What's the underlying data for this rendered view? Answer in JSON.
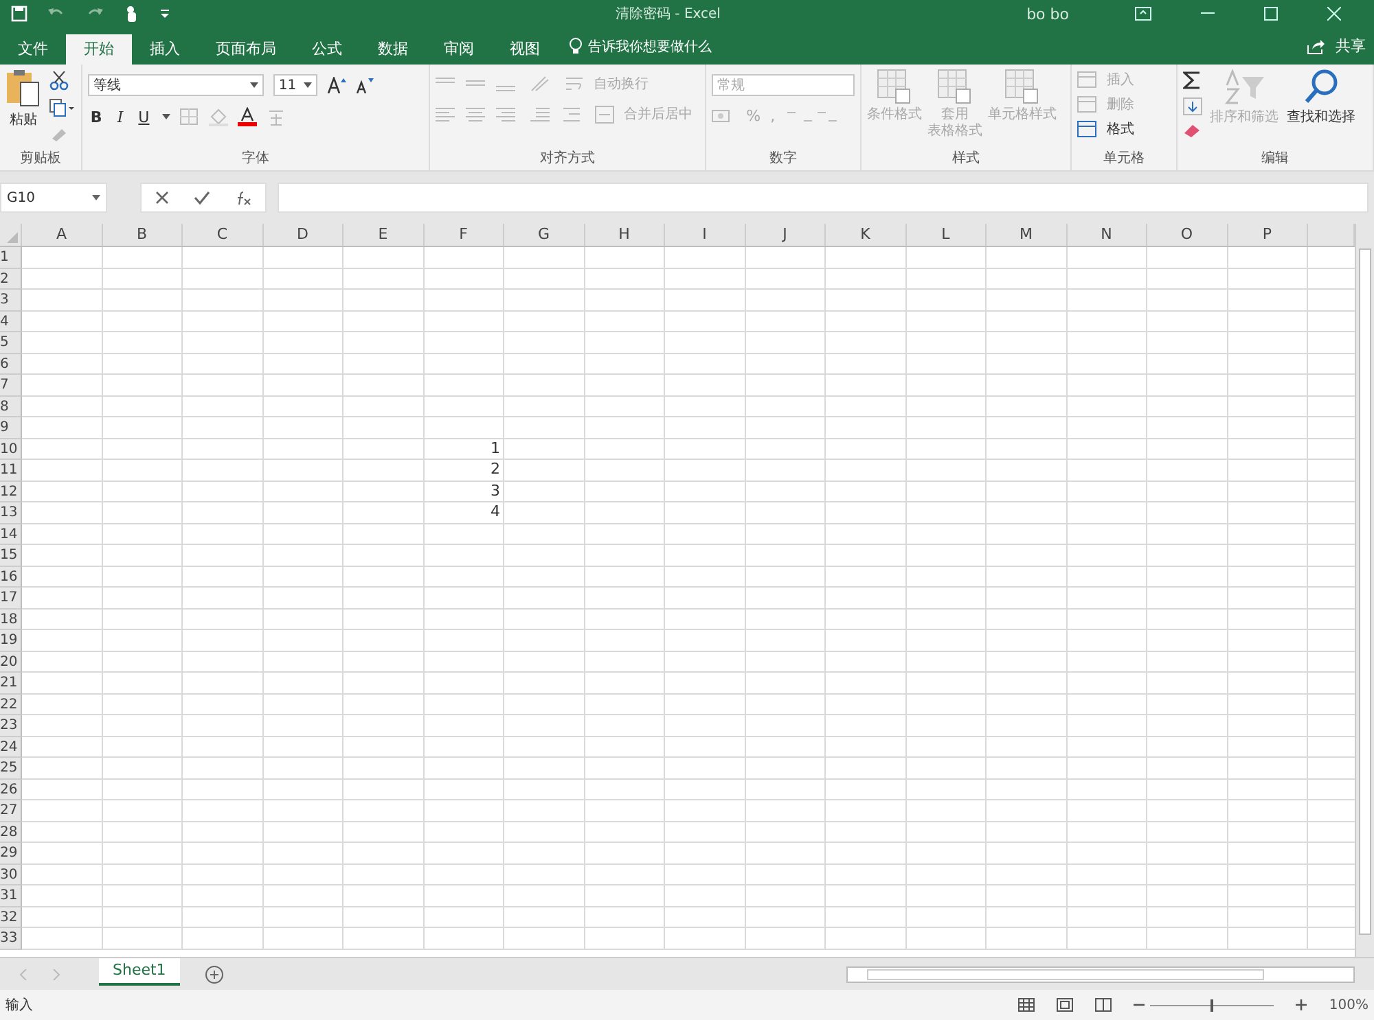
{
  "window": {
    "title": "清除密码 - Excel",
    "user": "bo bo"
  },
  "tabs": [
    {
      "label": "文件",
      "selected": false
    },
    {
      "label": "开始",
      "selected": true
    },
    {
      "label": "插入",
      "selected": false
    },
    {
      "label": "页面布局",
      "selected": false
    },
    {
      "label": "公式",
      "selected": false
    },
    {
      "label": "数据",
      "selected": false
    },
    {
      "label": "审阅",
      "selected": false
    },
    {
      "label": "视图",
      "selected": false
    }
  ],
  "tell_me": "告诉我你想要做什么",
  "share": "共享",
  "ribbon": {
    "clipboard": {
      "paste": "粘贴",
      "group": "剪贴板"
    },
    "font": {
      "name": "等线",
      "size": "11",
      "bold": "B",
      "italic": "I",
      "underline": "U",
      "group": "字体"
    },
    "alignment": {
      "wrap": "自动换行",
      "merge": "合并后居中",
      "group": "对齐方式"
    },
    "number": {
      "format": "常规",
      "percent": "%",
      "comma": ",",
      "group": "数字"
    },
    "styles": {
      "items": [
        {
          "label": "条件格式",
          "disabled": true
        },
        {
          "label": "套用",
          "label_2": "表格格式",
          "disabled": true
        },
        {
          "label": "单元格样式",
          "disabled": true
        }
      ],
      "group": "样式"
    },
    "cells": {
      "items": [
        {
          "label": "插入",
          "disabled": true
        },
        {
          "label": "删除",
          "disabled": true
        },
        {
          "label": "格式",
          "disabled": false
        }
      ],
      "group": "单元格"
    },
    "editing": {
      "sort": {
        "label": "排序和筛选",
        "disabled": true
      },
      "find": {
        "label": "查找和选择",
        "disabled": false
      },
      "group": "编辑"
    }
  },
  "formula_bar": {
    "name_box": "G10"
  },
  "sheet": {
    "columns": [
      "A",
      "B",
      "C",
      "D",
      "E",
      "F",
      "G",
      "H",
      "I",
      "J",
      "K",
      "L",
      "M",
      "N",
      "O",
      "P"
    ],
    "rows": [
      {
        "label": "1"
      },
      {
        "label": "2"
      },
      {
        "label": "3"
      },
      {
        "label": "4"
      },
      {
        "label": "5"
      },
      {
        "label": "6"
      },
      {
        "label": "7"
      },
      {
        "label": "8"
      },
      {
        "label": "9"
      },
      {
        "label": "10",
        "cells": [
          null,
          null,
          null,
          null,
          null,
          "1"
        ]
      },
      {
        "label": "11",
        "cells": [
          null,
          null,
          null,
          null,
          null,
          "2"
        ]
      },
      {
        "label": "12",
        "cells": [
          null,
          null,
          null,
          null,
          null,
          "3"
        ]
      },
      {
        "label": "13",
        "cells": [
          null,
          null,
          null,
          null,
          null,
          "4"
        ]
      },
      {
        "label": "14"
      },
      {
        "label": "15"
      },
      {
        "label": "16"
      },
      {
        "label": "17"
      },
      {
        "label": "18"
      },
      {
        "label": "19"
      },
      {
        "label": "20"
      },
      {
        "label": "21"
      },
      {
        "label": "22"
      },
      {
        "label": "23"
      },
      {
        "label": "24"
      },
      {
        "label": "25"
      },
      {
        "label": "26"
      },
      {
        "label": "27"
      },
      {
        "label": "28"
      },
      {
        "label": "29"
      },
      {
        "label": "30"
      },
      {
        "label": "31"
      },
      {
        "label": "32"
      },
      {
        "label": "33"
      }
    ]
  },
  "sheet_tabs": [
    {
      "label": "Sheet1",
      "selected": true
    }
  ],
  "status": {
    "mode": "输入",
    "zoom": "100%",
    "zoom_slider": {
      "level": 0.5
    }
  }
}
